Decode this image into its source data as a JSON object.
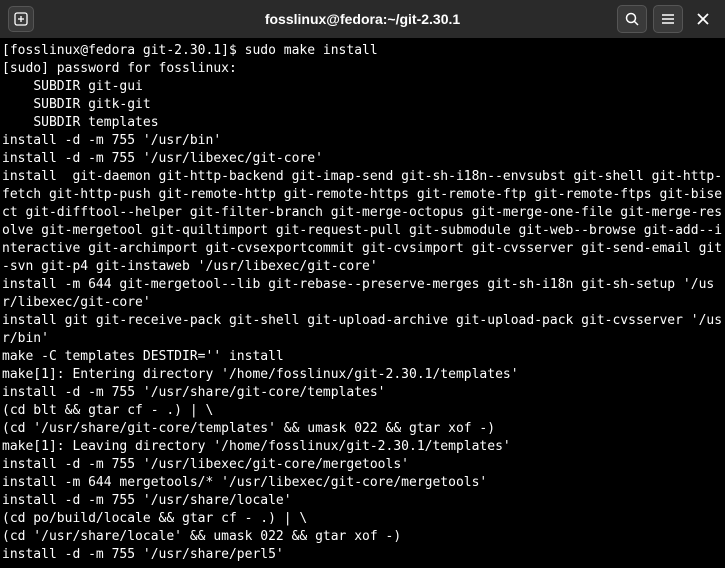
{
  "titlebar": {
    "title": "fosslinux@fedora:~/git-2.30.1"
  },
  "terminal": {
    "lines": [
      "[fosslinux@fedora git-2.30.1]$ sudo make install",
      "[sudo] password for fosslinux: ",
      "    SUBDIR git-gui",
      "    SUBDIR gitk-git",
      "    SUBDIR templates",
      "install -d -m 755 '/usr/bin'",
      "install -d -m 755 '/usr/libexec/git-core'",
      "install  git-daemon git-http-backend git-imap-send git-sh-i18n--envsubst git-shell git-http-fetch git-http-push git-remote-http git-remote-https git-remote-ftp git-remote-ftps git-bisect git-difftool--helper git-filter-branch git-merge-octopus git-merge-one-file git-merge-resolve git-mergetool git-quiltimport git-request-pull git-submodule git-web--browse git-add--interactive git-archimport git-cvsexportcommit git-cvsimport git-cvsserver git-send-email git-svn git-p4 git-instaweb '/usr/libexec/git-core'",
      "install -m 644 git-mergetool--lib git-rebase--preserve-merges git-sh-i18n git-sh-setup '/usr/libexec/git-core'",
      "install git git-receive-pack git-shell git-upload-archive git-upload-pack git-cvsserver '/usr/bin'",
      "make -C templates DESTDIR='' install",
      "make[1]: Entering directory '/home/fosslinux/git-2.30.1/templates'",
      "install -d -m 755 '/usr/share/git-core/templates'",
      "(cd blt && gtar cf - .) | \\",
      "(cd '/usr/share/git-core/templates' && umask 022 && gtar xof -)",
      "make[1]: Leaving directory '/home/fosslinux/git-2.30.1/templates'",
      "install -d -m 755 '/usr/libexec/git-core/mergetools'",
      "install -m 644 mergetools/* '/usr/libexec/git-core/mergetools'",
      "install -d -m 755 '/usr/share/locale'",
      "(cd po/build/locale && gtar cf - .) | \\",
      "(cd '/usr/share/locale' && umask 022 && gtar xof -)",
      "install -d -m 755 '/usr/share/perl5'"
    ]
  }
}
